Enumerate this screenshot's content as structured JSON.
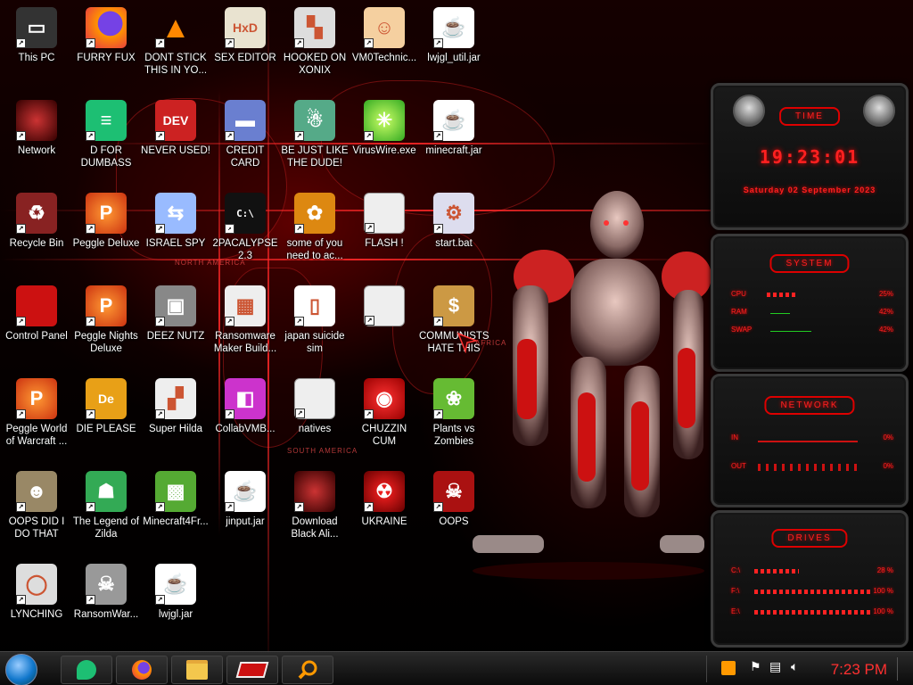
{
  "desktop": {
    "icons": [
      {
        "label": "This PC",
        "icon": "computer-icon"
      },
      {
        "label": "FURRY FUX",
        "icon": "firefox-icon"
      },
      {
        "label": "DONT STICK THIS IN YO...",
        "icon": "vlc-cone-icon"
      },
      {
        "label": "SEX EDITOR",
        "icon": "hxd-icon"
      },
      {
        "label": "HOOKED ON XONIX",
        "icon": "xonix-icon"
      },
      {
        "label": "VM0Technic...",
        "icon": "doctor-icon"
      },
      {
        "label": "lwjgl_util.jar",
        "icon": "java-icon"
      },
      {
        "label": "Network",
        "icon": "alien-network-icon"
      },
      {
        "label": "D FOR DUMBASS",
        "icon": "chat-bubble-icon"
      },
      {
        "label": "NEVER USED!",
        "icon": "devcpp-icon"
      },
      {
        "label": "CREDIT CARD CHECKER",
        "icon": "credit-card-icon"
      },
      {
        "label": "BE JUST LIKE THE DUDE!",
        "icon": "santa-icon"
      },
      {
        "label": "VirusWire.exe",
        "icon": "lime-icon"
      },
      {
        "label": "minecraft.jar",
        "icon": "java-icon"
      },
      {
        "label": "Recycle Bin",
        "icon": "recycle-bin-icon"
      },
      {
        "label": "Peggle Deluxe",
        "icon": "peggle-icon"
      },
      {
        "label": "ISRAEL SPY",
        "icon": "network-share-icon"
      },
      {
        "label": "2PACALYPSE 2.3",
        "icon": "terminal-icon"
      },
      {
        "label": "some of you need to ac...",
        "icon": "dog-icon"
      },
      {
        "label": "FLASH !",
        "icon": "file-icon"
      },
      {
        "label": "start.bat",
        "icon": "batch-gear-icon"
      },
      {
        "label": "Control Panel",
        "icon": "control-panel-icon"
      },
      {
        "label": "Peggle Nights Deluxe",
        "icon": "peggle-icon"
      },
      {
        "label": "DEEZ NUTZ",
        "icon": "stacked-windows-icon"
      },
      {
        "label": "Ransomware Maker Build...",
        "icon": "window-app-icon"
      },
      {
        "label": "japan suicide sim",
        "icon": "document-icon"
      },
      {
        "label": "",
        "icon": "file-icon"
      },
      {
        "label": "COMMUNISTS HATE THIS G...",
        "icon": "money-bag-icon"
      },
      {
        "label": "Peggle World of Warcraft ...",
        "icon": "peggle-icon"
      },
      {
        "label": "DIE PLEASE",
        "icon": "dreamweaver-icon"
      },
      {
        "label": "Super Hilda",
        "icon": "pixel-cat-icon"
      },
      {
        "label": "CollabVMB...",
        "icon": "collabvm-icon"
      },
      {
        "label": "natives",
        "icon": "folder-icon"
      },
      {
        "label": "CHUZZIN CUM",
        "icon": "chuzzle-icon"
      },
      {
        "label": "Plants vs Zombies",
        "icon": "flower-icon"
      },
      {
        "label": "OOPS DID I DO THAT",
        "icon": "portrait-icon"
      },
      {
        "label": "The Legend of Zilda",
        "icon": "link-icon"
      },
      {
        "label": "Minecraft4Fr...",
        "icon": "grass-block-icon"
      },
      {
        "label": "jinput.jar",
        "icon": "java-icon"
      },
      {
        "label": "Download Black Ali...",
        "icon": "alien-network-icon"
      },
      {
        "label": "UKRAINE",
        "icon": "radiation-icon"
      },
      {
        "label": "OOPS",
        "icon": "skull-book-icon"
      },
      {
        "label": "LYNCHING",
        "icon": "rope-icon"
      },
      {
        "label": "RansomWar...",
        "icon": "skull-ring-icon"
      },
      {
        "label": "lwjgl.jar",
        "icon": "java-icon"
      }
    ]
  },
  "map": {
    "labels": [
      "NORTH AMERICA",
      "SOUTH AMERICA",
      "AFRICA"
    ]
  },
  "widgets": {
    "time": {
      "title": "TIME",
      "clock": "19:23:01",
      "date": "Saturday 02 September 2023"
    },
    "system": {
      "title": "SYSTEM",
      "rows": [
        {
          "label": "CPU",
          "value": "25%",
          "fraction": 0.25
        },
        {
          "label": "RAM",
          "value": "42%",
          "fraction": 0.42
        },
        {
          "label": "SWAP",
          "value": "42%",
          "fraction": 0.42
        }
      ]
    },
    "network": {
      "title": "NETWORK",
      "rows": [
        {
          "label": "IN",
          "value": "0%"
        },
        {
          "label": "OUT",
          "value": "0%"
        }
      ]
    },
    "drives": {
      "title": "DRIVES",
      "rows": [
        {
          "label": "C:\\",
          "value": "28 %",
          "fraction": 0.28
        },
        {
          "label": "F:\\",
          "value": "100 %",
          "fraction": 1.0
        },
        {
          "label": "E:\\",
          "value": "100 %",
          "fraction": 1.0
        }
      ]
    }
  },
  "taskbar": {
    "items": [
      "chat-bubble-icon",
      "firefox-icon",
      "file-explorer-icon",
      "control-panel-icon",
      "search-magnifier-icon"
    ],
    "tray_icons": [
      "notification-icon",
      "flag-icon",
      "network-icon",
      "volume-icon"
    ],
    "clock": "7:23 PM"
  },
  "colors": {
    "accent": "#ff2020",
    "clock": "#ff3030"
  }
}
